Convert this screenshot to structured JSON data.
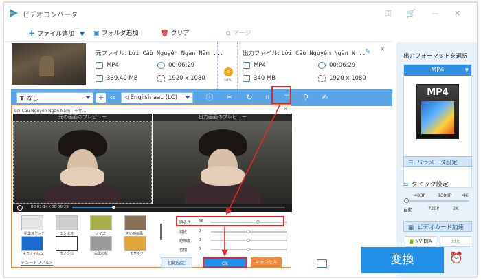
{
  "app": {
    "title": "ビデオコンバータ"
  },
  "toolbar": {
    "add_file": "ファイル追加",
    "add_folder": "フォルダ追加",
    "clear": "クリア",
    "merge": "マージ"
  },
  "file": {
    "source_label": "元ファイル:",
    "source_name": "Lời Cầu Nguyện Ngàn Năm ...",
    "output_label": "出力ファイル:",
    "output_name": "Lời Cầu Nguyện Ngàn N...",
    "src_format": "MP4",
    "src_duration": "00:06:29",
    "src_size": "339.40 MB",
    "src_res": "1920 x 1080",
    "out_format": "MP4",
    "out_duration": "00:06:29",
    "out_size": "340 MB",
    "out_res": "1920 x 1080",
    "gpu_label": "GPU"
  },
  "editbar": {
    "subtitle": "なし",
    "audio": "English aac (LC)"
  },
  "right_panel": {
    "output_format_title": "出力フォーマットを選択",
    "format": "MP4",
    "format_badge": "MP4",
    "param_button": "パラメータ設定",
    "quick_setting": "クイック設定",
    "slider_top": [
      "480P",
      "1080P",
      "4K"
    ],
    "slider_bottom": [
      "自動",
      "720P",
      "2K"
    ],
    "gpu_accel": "ビデオカード加速",
    "vendors": [
      "NVIDIA",
      "Intel"
    ]
  },
  "convert_button": "変換",
  "dialog": {
    "title": "Lời Cầu Nguyện Ngàn Năm - 千年...",
    "orig_preview": "元の画面のプレビュー",
    "out_preview": "出力画面のプレビュー",
    "time": "00:01:14 / 00:06:29",
    "effects": [
      "鉛筆スケッチ",
      "エンボス",
      "ノイズ",
      "古い映画風",
      "ネガフィルム",
      "モノクロ",
      "白黒の粒",
      "モザイク"
    ],
    "adjust": [
      {
        "label": "明るさ",
        "value": "68"
      },
      {
        "label": "対比",
        "value": "0"
      },
      {
        "label": "飽和度",
        "value": "0"
      },
      {
        "label": "色相",
        "value": "0"
      }
    ],
    "tutorial": "チュートリアル>",
    "reset": "初期設定",
    "ok": "Ok",
    "cancel": "キャンセル"
  }
}
